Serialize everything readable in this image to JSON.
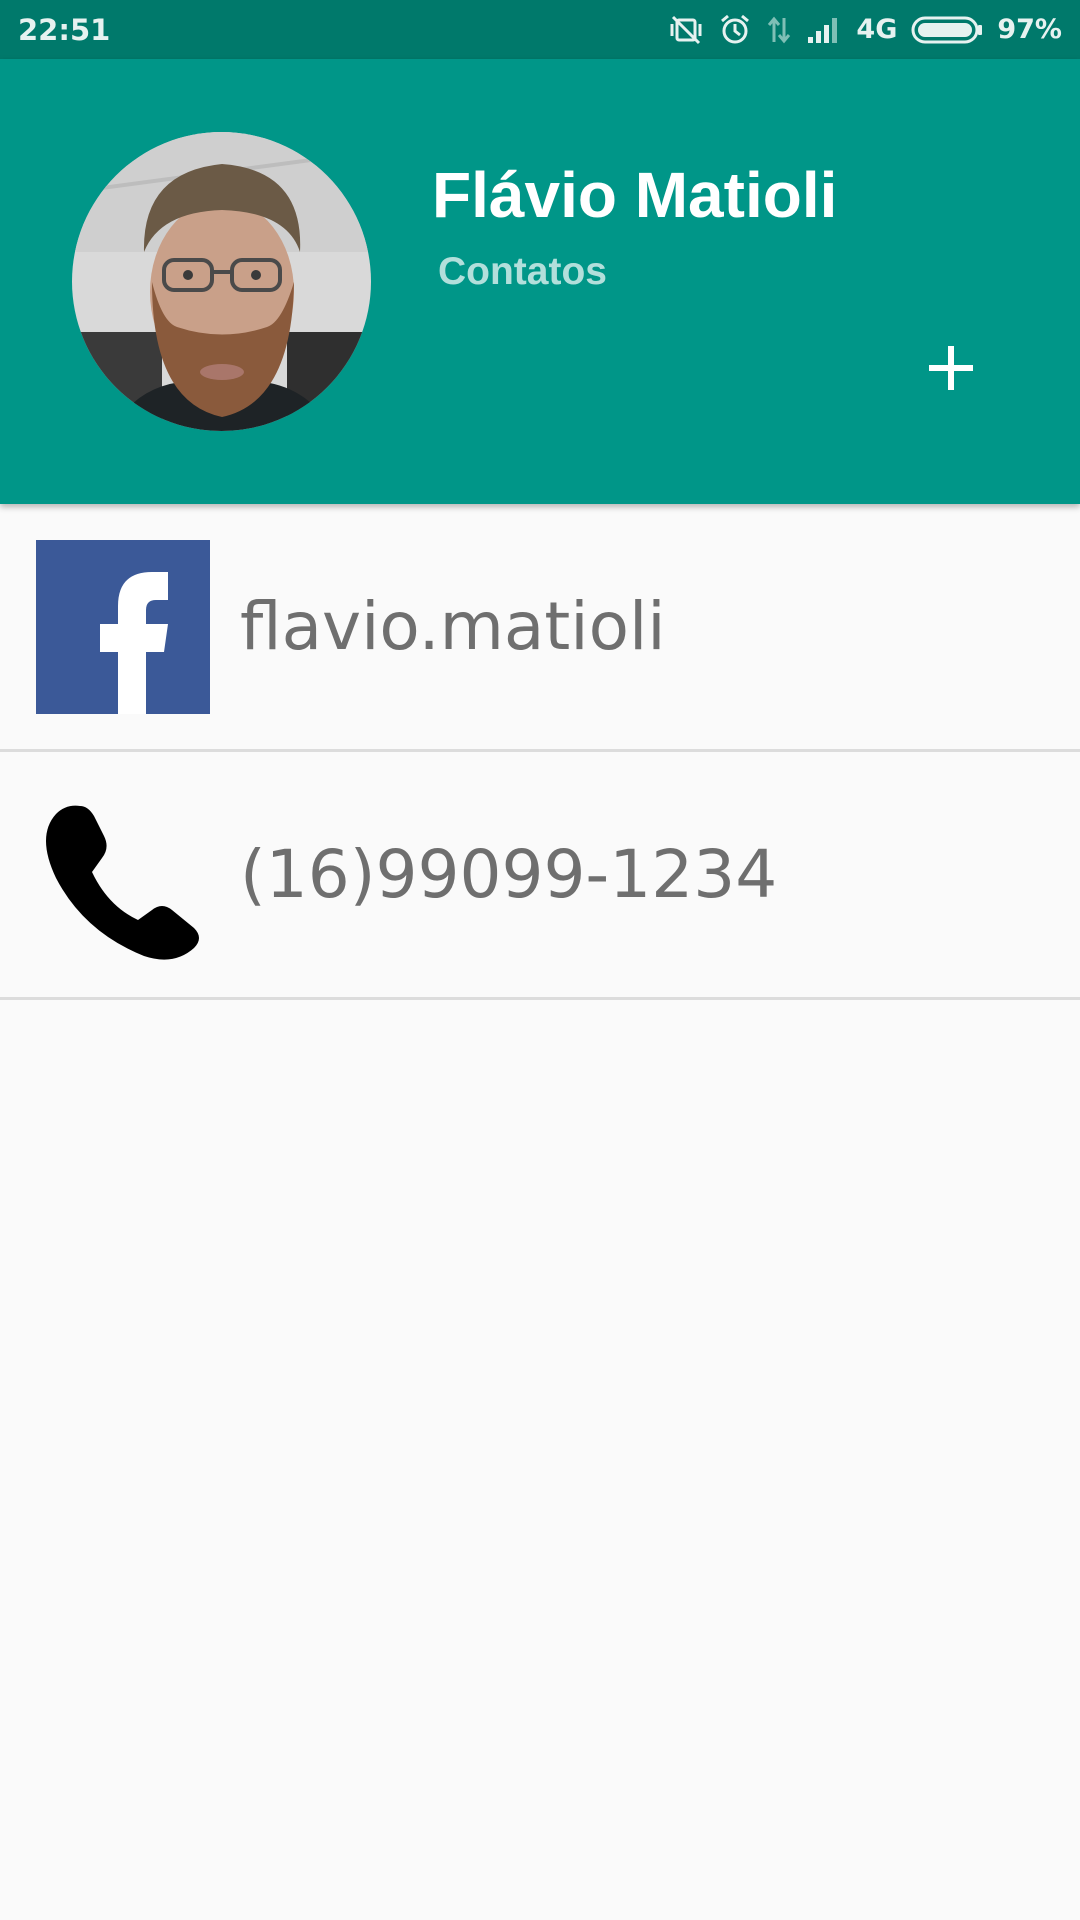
{
  "status_bar": {
    "time": "22:51",
    "network": "4G",
    "battery": "97%",
    "icons": [
      "vibrate-off-icon",
      "alarm-icon",
      "data-arrows-icon",
      "signal-icon",
      "battery-icon"
    ]
  },
  "header": {
    "name": "Flávio Matioli",
    "subtitle": "Contatos",
    "add_icon": "plus-icon",
    "avatar": "contact-photo"
  },
  "contacts": [
    {
      "type": "facebook",
      "icon": "facebook-icon",
      "value": "flavio.matioli"
    },
    {
      "type": "phone",
      "icon": "phone-icon",
      "value": "(16)99099-1234"
    }
  ],
  "colors": {
    "status_bar": "#00796b",
    "header": "#009688",
    "facebook": "#3b5998",
    "background": "#fafafa",
    "item_text": "#6f6f6f"
  }
}
